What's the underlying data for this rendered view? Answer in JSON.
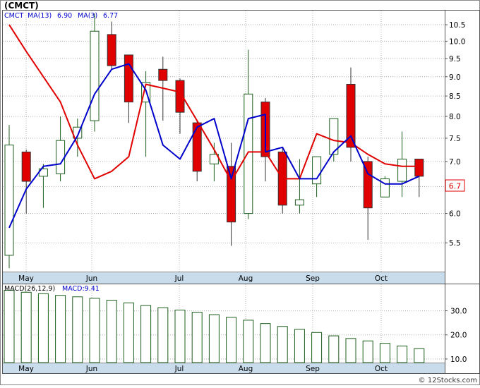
{
  "title": "(CMCT)",
  "footer": "© 12Stocks.com",
  "colors": {
    "up_stroke": "#1c5e1c",
    "down_fill": "#e00000",
    "ma13": "#e00000",
    "ma3": "#0000cc",
    "grid": "#b0b0b0",
    "axis_band": "#c8dceb",
    "macd_bar": "#1c5e1c"
  },
  "chart_data": [
    {
      "type": "candlestick",
      "ticker": "CMCT",
      "legend": [
        {
          "label": "CMCT",
          "value": "",
          "color": "#0000cc"
        },
        {
          "label": "MA(13)",
          "value": "6.90",
          "color": "#0000cc"
        },
        {
          "label": "MA(3)",
          "value": "6.77",
          "color": "#0000cc"
        }
      ],
      "y_scale": "log",
      "ylim": [
        5.05,
        10.95
      ],
      "y_ticks": [
        5.5,
        6.0,
        6.5,
        7.0,
        7.5,
        8.0,
        8.5,
        9.0,
        9.5,
        10.0,
        10.5
      ],
      "y_tick_labels": [
        "5.5",
        "6.0",
        "6.5",
        "7.0",
        "7.5",
        "8.0",
        "8.5",
        "9.0",
        "9.5",
        "10.0",
        "10.5"
      ],
      "x_months": [
        "May",
        "Jun",
        "Jul",
        "Aug",
        "Sep",
        "Oct"
      ],
      "last_price_label": "6.7",
      "grid": true,
      "candles": [
        {
          "open": 5.3,
          "close": 7.35,
          "high": 7.8,
          "low": 5.1
        },
        {
          "open": 7.2,
          "close": 6.6,
          "high": 7.25,
          "low": 6.0
        },
        {
          "open": 6.7,
          "close": 6.85,
          "high": 6.95,
          "low": 6.1
        },
        {
          "open": 6.75,
          "close": 7.45,
          "high": 8.0,
          "low": 6.6
        },
        {
          "open": 7.5,
          "close": 7.75,
          "high": 7.95,
          "low": 7.1
        },
        {
          "open": 7.9,
          "close": 10.3,
          "high": 10.85,
          "low": 7.65
        },
        {
          "open": 10.2,
          "close": 9.3,
          "high": 10.6,
          "low": 9.2
        },
        {
          "open": 9.6,
          "close": 8.35,
          "high": 9.6,
          "low": 7.85
        },
        {
          "open": 8.35,
          "close": 8.85,
          "high": 9.15,
          "low": 7.1
        },
        {
          "open": 9.2,
          "close": 8.9,
          "high": 9.55,
          "low": 7.9
        },
        {
          "open": 8.9,
          "close": 8.1,
          "high": 8.95,
          "low": 7.6
        },
        {
          "open": 7.85,
          "close": 6.8,
          "high": 7.9,
          "low": 6.6
        },
        {
          "open": 6.95,
          "close": 7.15,
          "high": 7.4,
          "low": 6.6
        },
        {
          "open": 6.9,
          "close": 5.85,
          "high": 7.4,
          "low": 5.45
        },
        {
          "open": 6.0,
          "close": 8.55,
          "high": 9.75,
          "low": 5.9
        },
        {
          "open": 8.35,
          "close": 7.1,
          "high": 8.45,
          "low": 6.6
        },
        {
          "open": 7.2,
          "close": 6.15,
          "high": 7.3,
          "low": 6.0
        },
        {
          "open": 6.15,
          "close": 6.25,
          "high": 7.05,
          "low": 6.0
        },
        {
          "open": 6.55,
          "close": 7.1,
          "high": 7.1,
          "low": 6.3
        },
        {
          "open": 7.15,
          "close": 7.95,
          "high": 7.95,
          "low": 7.0
        },
        {
          "open": 8.8,
          "close": 7.3,
          "high": 9.25,
          "low": 7.0
        },
        {
          "open": 7.0,
          "close": 6.1,
          "high": 7.1,
          "low": 5.55
        },
        {
          "open": 6.3,
          "close": 6.65,
          "high": 6.7,
          "low": 6.3
        },
        {
          "open": 6.6,
          "close": 7.05,
          "high": 7.65,
          "low": 6.3
        },
        {
          "open": 7.05,
          "close": 6.7,
          "high": 7.05,
          "low": 6.3
        }
      ],
      "series": [
        {
          "name": "MA(13)",
          "color": "#e00000",
          "points": [
            [
              0,
              10.5
            ],
            [
              1,
              9.7
            ],
            [
              3,
              8.35
            ],
            [
              4,
              7.35
            ],
            [
              5,
              6.65
            ],
            [
              6,
              6.8
            ],
            [
              7,
              7.1
            ],
            [
              8,
              8.8
            ],
            [
              9,
              8.7
            ],
            [
              10,
              8.6
            ],
            [
              11,
              7.9
            ],
            [
              12,
              7.25
            ],
            [
              13,
              6.6
            ],
            [
              14,
              7.2
            ],
            [
              15,
              7.2
            ],
            [
              16,
              6.65
            ],
            [
              17,
              6.65
            ],
            [
              18,
              7.6
            ],
            [
              19,
              7.45
            ],
            [
              20,
              7.4
            ],
            [
              21,
              7.15
            ],
            [
              22,
              6.95
            ],
            [
              23,
              6.9
            ],
            [
              24,
              6.9
            ]
          ]
        },
        {
          "name": "MA(3)",
          "color": "#0000cc",
          "points": [
            [
              0,
              5.75
            ],
            [
              1,
              6.45
            ],
            [
              2,
              6.9
            ],
            [
              3,
              6.95
            ],
            [
              4,
              7.55
            ],
            [
              5,
              8.55
            ],
            [
              6,
              9.2
            ],
            [
              7,
              9.35
            ],
            [
              8,
              8.65
            ],
            [
              9,
              7.35
            ],
            [
              10,
              7.05
            ],
            [
              11,
              7.75
            ],
            [
              12,
              7.95
            ],
            [
              13,
              6.65
            ],
            [
              14,
              7.95
            ],
            [
              15,
              8.05
            ],
            [
              15,
              7.2
            ],
            [
              16,
              7.3
            ],
            [
              17,
              6.65
            ],
            [
              18,
              6.65
            ],
            [
              19,
              7.2
            ],
            [
              20,
              7.55
            ],
            [
              21,
              6.75
            ],
            [
              22,
              6.55
            ],
            [
              23,
              6.55
            ],
            [
              24,
              6.7
            ]
          ]
        }
      ]
    },
    {
      "type": "bar",
      "legend": [
        {
          "label": "MACD(26,12,9)",
          "color": "#000000"
        },
        {
          "label": "MACD:9.41",
          "color": "#0000cc"
        }
      ],
      "ylim": [
        8.5,
        41
      ],
      "y_ticks": [
        10,
        20,
        30
      ],
      "y_tick_labels": [
        "10.0",
        "20.0",
        "30.0"
      ],
      "x_months": [
        "May",
        "Jun",
        "Jul",
        "Aug",
        "Sep",
        "Oct"
      ],
      "values": [
        38.5,
        37.7,
        37.1,
        36.4,
        35.8,
        35.2,
        34.4,
        33.3,
        32.2,
        31.3,
        30.3,
        29.4,
        28.4,
        27.3,
        26.1,
        24.7,
        23.5,
        22.3,
        21.0,
        19.6,
        18.5,
        17.5,
        16.5,
        15.4,
        14.3
      ]
    }
  ]
}
